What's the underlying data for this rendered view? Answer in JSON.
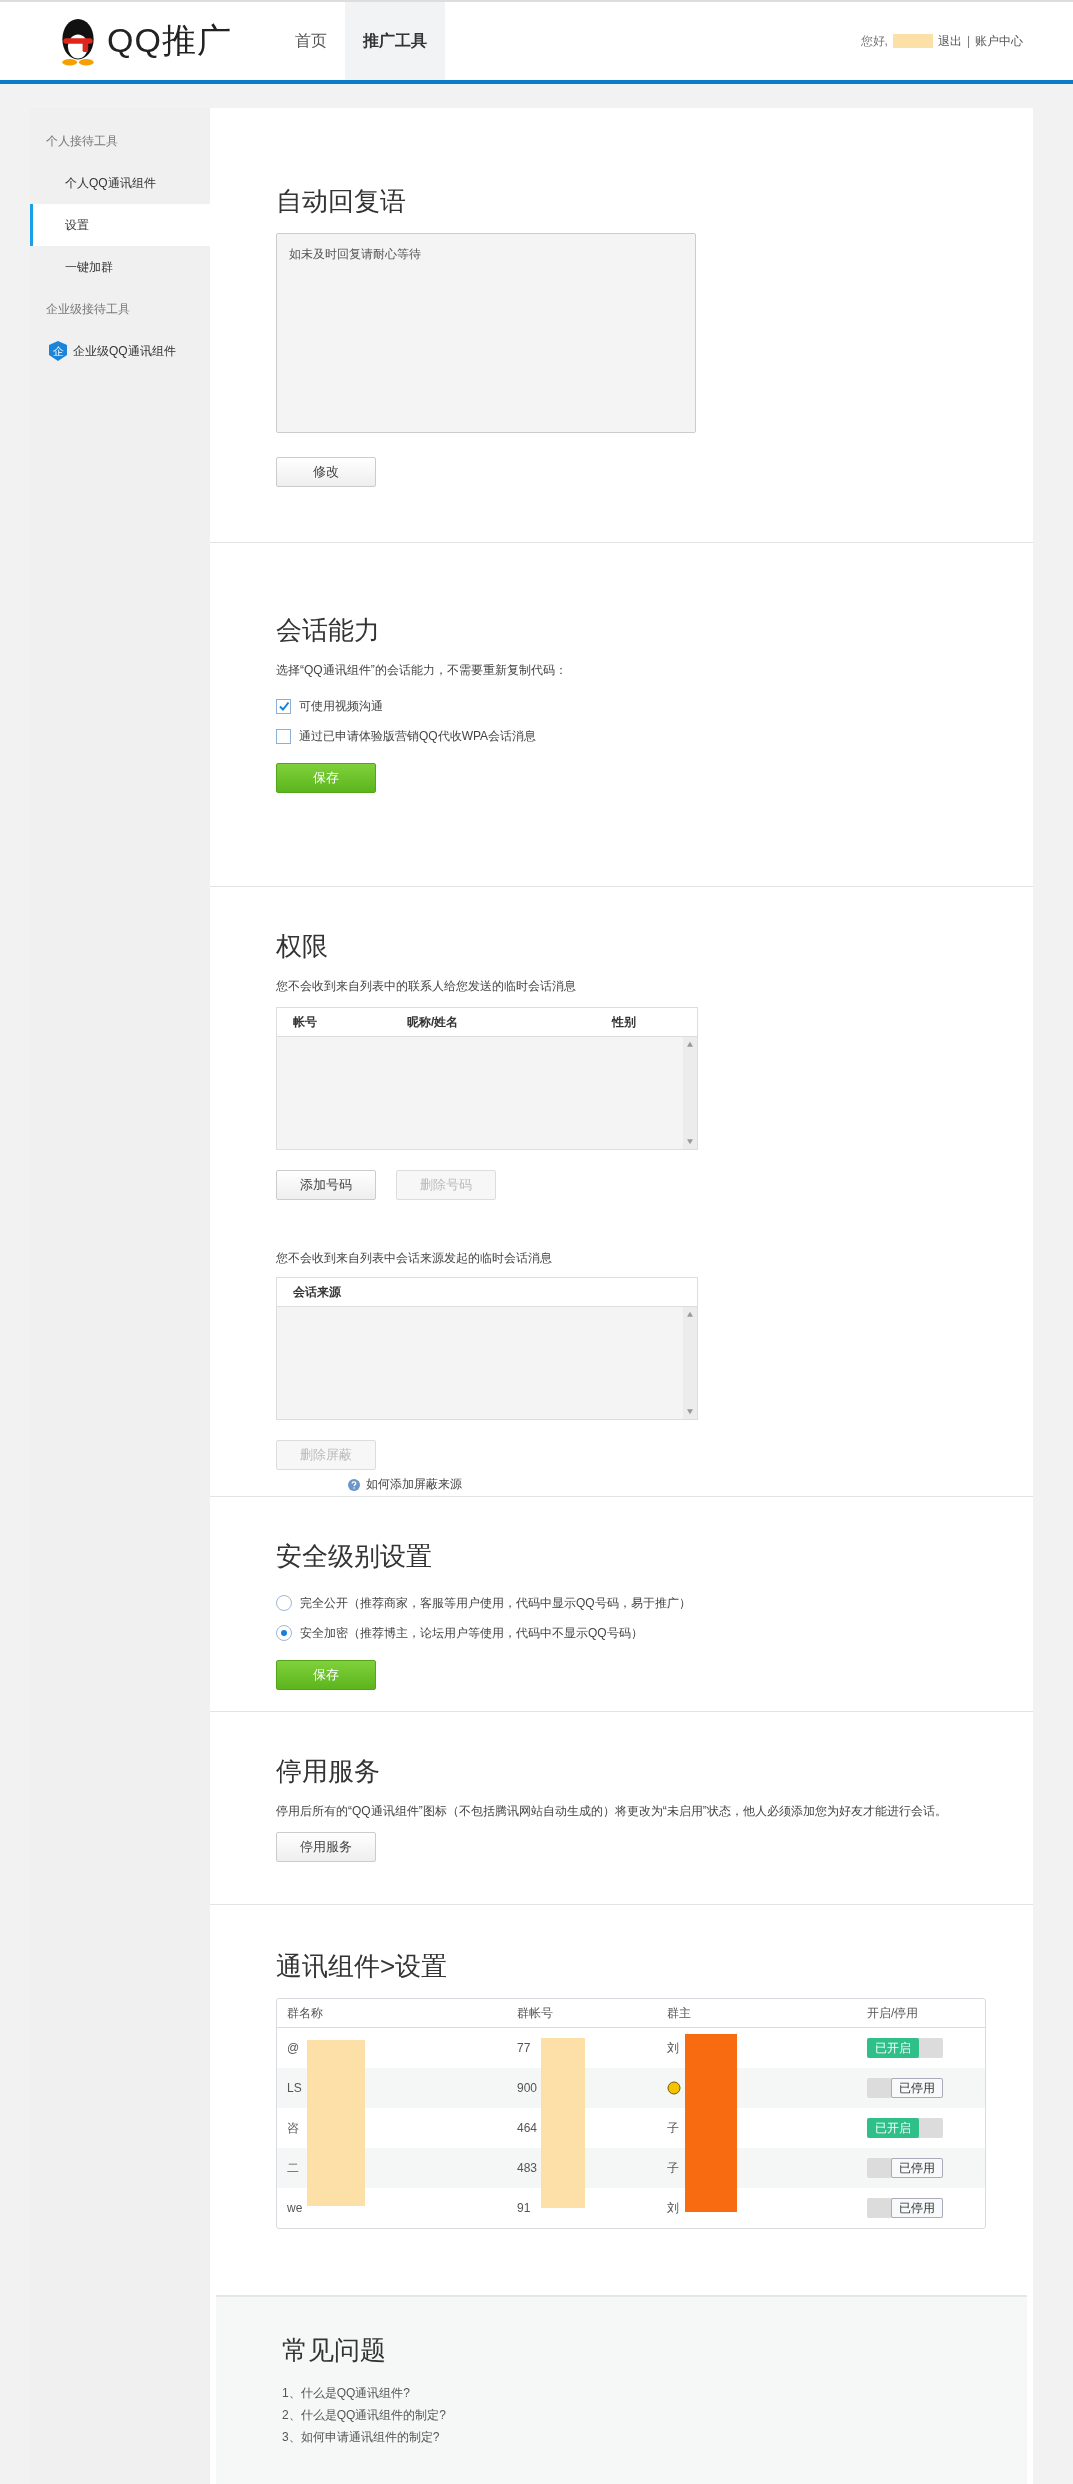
{
  "header": {
    "logo_text": "QQ推广",
    "nav": [
      {
        "label": "首页",
        "selected": false
      },
      {
        "label": "推广工具",
        "selected": true
      }
    ],
    "greeting": "您好,",
    "logout": "退出",
    "separator": "|",
    "account": "账户中心"
  },
  "sidebar": {
    "groups": [
      {
        "label": "个人接待工具",
        "items": [
          {
            "label": "个人QQ通讯组件",
            "selected": false
          },
          {
            "label": "设置",
            "selected": true
          },
          {
            "label": "一键加群",
            "selected": false
          }
        ]
      },
      {
        "label": "企业级接待工具",
        "items": [
          {
            "label": "企业级QQ通讯组件",
            "selected": false,
            "badge": "企"
          }
        ]
      }
    ]
  },
  "auto_reply": {
    "title": "自动回复语",
    "text": "如未及时回复请耐心等待",
    "button": "修改"
  },
  "session": {
    "title": "会话能力",
    "description": "选择“QQ通讯组件”的会话能力，不需要重新复制代码：",
    "options": [
      {
        "label": "可使用视频沟通",
        "checked": true
      },
      {
        "label": "通过已申请体验版营销QQ代收WPA会话消息",
        "checked": false
      }
    ],
    "button": "保存"
  },
  "permissions": {
    "title": "权限",
    "contacts_note": "您不会收到来自列表中的联系人给您发送的临时会话消息",
    "contacts_columns": [
      "帐号",
      "昵称/姓名",
      "性别"
    ],
    "contacts_buttons": [
      {
        "label": "添加号码",
        "disabled": false
      },
      {
        "label": "删除号码",
        "disabled": true
      }
    ],
    "sources_note": "您不会收到来自列表中会话来源发起的临时会话消息",
    "sources_columns": [
      "会话来源"
    ],
    "sources_button": {
      "label": "删除屏蔽",
      "disabled": true
    },
    "help_link": "如何添加屏蔽来源"
  },
  "security": {
    "title": "安全级别设置",
    "options": [
      {
        "label": "完全公开（推荐商家，客服等用户使用，代码中显示QQ号码，易于推广）",
        "selected": false
      },
      {
        "label": "安全加密（推荐博主，论坛用户等使用，代码中不显示QQ号码）",
        "selected": true
      }
    ],
    "button": "保存"
  },
  "stop_service": {
    "title": "停用服务",
    "description": "停用后所有的“QQ通讯组件”图标（不包括腾讯网站自动生成的）将更改为“未启用”状态，他人必须添加您为好友才能进行会话。",
    "button": "停用服务"
  },
  "groups_table": {
    "title": "通讯组件>设置",
    "columns": [
      "群名称",
      "群帐号",
      "群主",
      "开启/停用"
    ],
    "rows": [
      {
        "name": "@",
        "account": "77",
        "owner": "刘",
        "owner_emoji": false,
        "on": true,
        "label": "已开启"
      },
      {
        "name": "LS",
        "account": "900",
        "owner_emoji": true,
        "on": false,
        "label": "已停用"
      },
      {
        "name": "咨",
        "account": "464",
        "owner": "子",
        "owner_emoji": false,
        "on": true,
        "label": "已开启"
      },
      {
        "name": "二",
        "account": "483",
        "owner": "子",
        "owner_emoji": false,
        "on": false,
        "label": "已停用"
      },
      {
        "name": "we",
        "account": "91",
        "owner": "刘",
        "owner_emoji": false,
        "on": false,
        "label": "已停用"
      }
    ]
  },
  "faq": {
    "title": "常见问题",
    "items": [
      "1、什么是QQ通讯组件?",
      "2、什么是QQ通讯组件的制定?",
      "3、如何申请通讯组件的制定?"
    ]
  }
}
